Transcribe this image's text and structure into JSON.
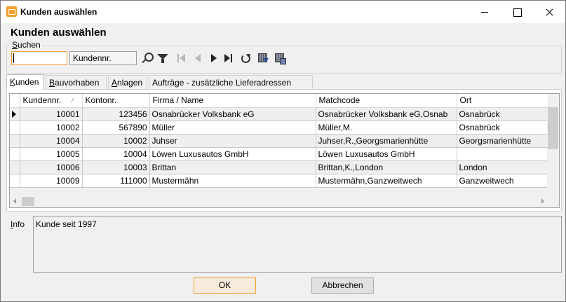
{
  "window": {
    "title": "Kunden auswählen"
  },
  "dialog": {
    "heading": "Kunden auswählen"
  },
  "search": {
    "group_label_prefix": "",
    "group_label_underlined": "S",
    "group_label_rest": "uchen",
    "input_value": "",
    "field_select": "Kundennr."
  },
  "tabs": [
    {
      "u": "K",
      "rest": "unden"
    },
    {
      "u": "B",
      "rest": "auvorhaben"
    },
    {
      "u": "A",
      "rest": "nlagen"
    },
    {
      "u": "",
      "rest": "Aufträge - zusätzliche Lieferadressen"
    }
  ],
  "table": {
    "headers": [
      "Kundennr.",
      "Kontonr.",
      "Firma / Name",
      "Matchcode",
      "Ort"
    ],
    "rows": [
      [
        "10001",
        "123456",
        "Osnabrücker Volksbank eG",
        "Osnabrücker Volksbank eG,Osnab",
        "Osnabrück"
      ],
      [
        "10002",
        "567890",
        "Müller",
        "Müller,M.",
        "Osnabrück"
      ],
      [
        "10004",
        "10002",
        "Juhser",
        "Juhser,R.,Georgsmarienhütte",
        "Georgsmarienhütte"
      ],
      [
        "10005",
        "10004",
        "Löwen Luxusautos GmbH",
        "Löwen Luxusautos GmbH",
        ""
      ],
      [
        "10006",
        "10003",
        "Brittan",
        "Brittan,K.,London",
        "London"
      ],
      [
        "10009",
        "111000",
        "Mustermähn",
        "Mustermähn,Ganzweitwech",
        "Ganzweitwech"
      ]
    ]
  },
  "info": {
    "label_underlined": "I",
    "label_rest": "nfo",
    "text": "Kunde seit 1997"
  },
  "buttons": {
    "ok": "OK",
    "cancel": "Abbrechen"
  },
  "colors": {
    "accent": "#f0a030"
  }
}
